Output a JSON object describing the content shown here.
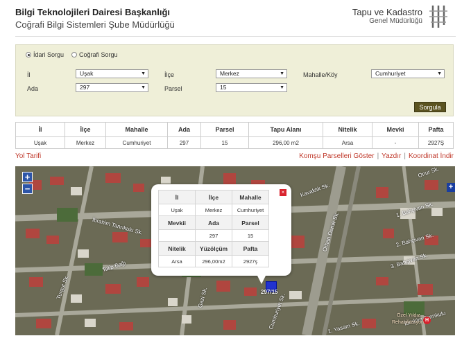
{
  "header": {
    "title": "Bilgi Teknolojileri Dairesi Başkanlığı",
    "subtitle": "Coğrafi Bilgi Sistemleri Şube Müdürlüğü",
    "logo_line1": "Tapu ve Kadastro",
    "logo_line2": "Genel Müdürlüğü"
  },
  "query": {
    "radio_idari": "İdari Sorgu",
    "radio_cografi": "Coğrafi Sorgu",
    "selected": "idari",
    "labels": {
      "il": "İl",
      "ilce": "İlçe",
      "mahalle": "Mahalle/Köy",
      "ada": "Ada",
      "parsel": "Parsel"
    },
    "values": {
      "il": "Uşak",
      "ilce": "Merkez",
      "mahalle": "Cumhuriyet",
      "ada": "297",
      "parsel": "15"
    },
    "submit_label": "Sorgula"
  },
  "results": {
    "headers": [
      "İl",
      "İlçe",
      "Mahalle",
      "Ada",
      "Parsel",
      "Tapu Alanı",
      "Nitelik",
      "Mevki",
      "Pafta"
    ],
    "row": [
      "Uşak",
      "Merkez",
      "Cumhuriyet",
      "297",
      "15",
      "296,00 m2",
      "Arsa",
      "-",
      "2927Ş"
    ]
  },
  "links": {
    "directions": "Yol Tarifi",
    "neighbors": "Komşu Parselleri Göster",
    "print": "Yazdır",
    "export": "Koordinat İndir"
  },
  "map": {
    "zoom_in": "+",
    "zoom_out": "−",
    "layers": "+",
    "parcel_label": "297/15",
    "hospital": "H",
    "poi_line1": "Özel Yıldız",
    "poi_line2": "Rehabilitasyon",
    "streets": [
      "İbrahim Tanrıkulu Sk.",
      "Gazi Sk.",
      "Cumhuriyet Sk.",
      "Orhan Demir Sk.",
      "1. Bahçivan Sk.",
      "3. Bahçivan Sk.",
      "2. Bahçivan Sk.",
      "Onur Sk.",
      "Kavaklık Sk.",
      "Talip Bağı",
      "Turgut Sk.",
      "1. Yasam Sk.",
      "İbrahim Tanrıkulu"
    ],
    "popup": {
      "headers1": [
        "İl",
        "İlçe",
        "Mahalle"
      ],
      "values1": [
        "Uşak",
        "Merkez",
        "Cumhuriyet"
      ],
      "headers2": [
        "Mevkii",
        "Ada",
        "Parsel"
      ],
      "values2": [
        "",
        "297",
        "15"
      ],
      "headers3": [
        "Nitelik",
        "Yüzölçüm",
        "Pafta"
      ],
      "values3": [
        "Arsa",
        "296,00m2",
        "2927ş"
      ],
      "close": "×"
    }
  }
}
